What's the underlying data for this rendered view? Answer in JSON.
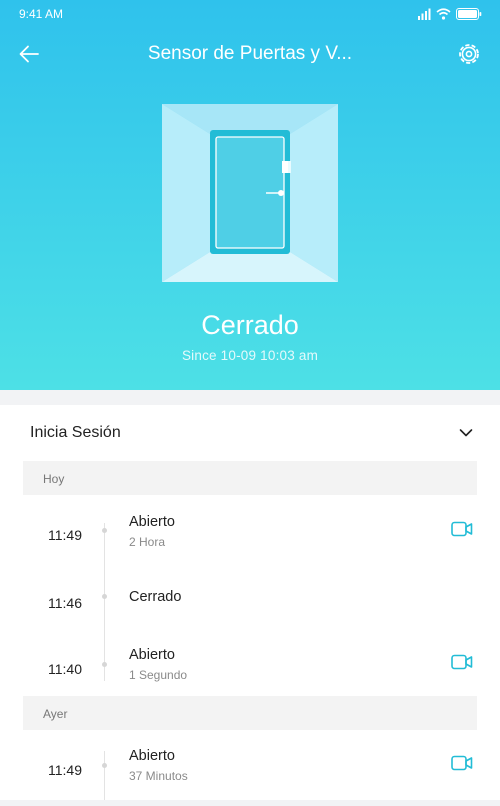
{
  "statusbar": {
    "time": "9:41 AM"
  },
  "header": {
    "title": "Sensor de Puertas y V..."
  },
  "device": {
    "state": "Cerrado",
    "since": "Since 10-09 10:03 am"
  },
  "session": {
    "label": "Inicia Sesión"
  },
  "groups": [
    {
      "label": "Hoy",
      "events": [
        {
          "time": "11:49",
          "title": "Abierto",
          "subtitle": "2 Hora",
          "has_video": true
        },
        {
          "time": "11:46",
          "title": "Cerrado",
          "subtitle": "",
          "has_video": false
        },
        {
          "time": "11:40",
          "title": "Abierto",
          "subtitle": "1 Segundo",
          "has_video": true
        }
      ]
    },
    {
      "label": "Ayer",
      "events": [
        {
          "time": "11:49",
          "title": "Abierto",
          "subtitle": "37 Minutos",
          "has_video": true
        }
      ]
    }
  ],
  "colors": {
    "hero_top": "#2fc2ec",
    "hero_bottom": "#4de0e6",
    "accent": "#22bcd6"
  },
  "icons": [
    "back-arrow-icon",
    "settings-gear-icon",
    "door-icon",
    "chevron-down-icon",
    "camera-icon",
    "wifi-icon",
    "signal-icon",
    "battery-icon"
  ]
}
